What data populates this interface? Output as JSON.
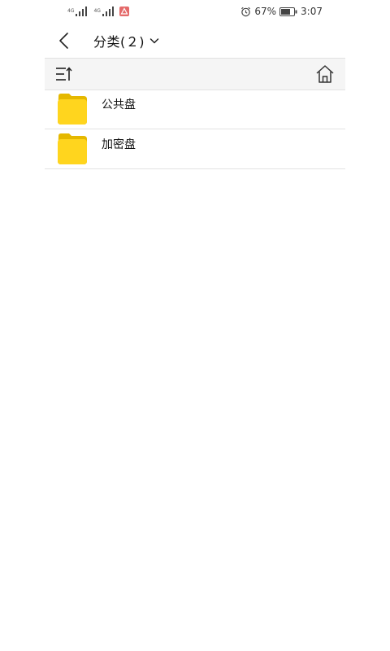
{
  "status_bar": {
    "network_1": "4G",
    "network_2": "4G",
    "battery": "67%",
    "time": "3:07",
    "icons": [
      "signal-icon",
      "signal-icon",
      "alert-icon",
      "alarm-icon",
      "battery-icon"
    ]
  },
  "header": {
    "title": "分类(２)",
    "icons": [
      "back-icon",
      "chevron-down-icon"
    ]
  },
  "toolbar": {
    "icons": [
      "sort-icon",
      "home-icon"
    ]
  },
  "list": {
    "items": [
      {
        "label": "公共盘",
        "icon": "folder-icon"
      },
      {
        "label": "加密盘",
        "icon": "folder-icon"
      }
    ]
  },
  "colors": {
    "folder": "#FFD51E",
    "folder_tab": "#E5B800",
    "toolbar_bg": "#F5F5F5",
    "divider": "#E2E2E2",
    "alert": "#E46A6A"
  }
}
